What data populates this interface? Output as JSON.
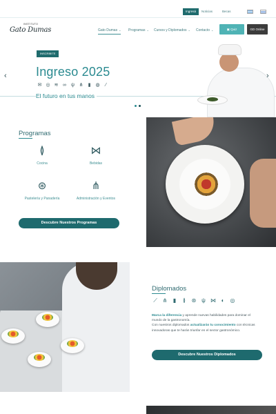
{
  "topbar": {
    "ingresa_label": "Ingresá",
    "links": [
      "Noticias",
      "Becas"
    ]
  },
  "header": {
    "logo_top": "INSTITUTO",
    "logo_name": "Gato Dumas",
    "nav": [
      {
        "label": "Gato Dumas"
      },
      {
        "label": "Programas"
      },
      {
        "label": "Cursos y Diplomados"
      },
      {
        "label": "Contacto"
      }
    ],
    "quiz_label": "Quiz",
    "online_label": "GD Online"
  },
  "hero": {
    "badge": "INSCRIBITE",
    "title": "Ingreso 2025",
    "subtitle": "El futuro en tus manos",
    "icons": [
      "✉",
      "◎",
      "≋",
      "∞",
      "ψ",
      "⋔",
      "▮",
      "◍",
      "⁄"
    ]
  },
  "programas": {
    "title": "Programas",
    "items": [
      {
        "icon": "≬",
        "label": "Cocina"
      },
      {
        "icon": "⋈",
        "label": "Bebidas"
      },
      {
        "icon": "⊛",
        "label": "Pastelería y Panadería"
      },
      {
        "icon": "⋔",
        "label": "Administración y Eventos"
      }
    ],
    "cta": "Descubre Nuestros Programas"
  },
  "diplomados": {
    "title": "Diplomados",
    "icons": [
      "⟋",
      "⋔",
      "▮",
      "≬",
      "⊛",
      "ψ",
      "⋈",
      "◐",
      "◎"
    ],
    "p1_bold": "Marca la diferencia",
    "p1_rest": " y aprende nuevas habilidades para dominar el mundo de la gastronomía.",
    "p2_start": "Con nuestros diplomados ",
    "p2_bold": "actualizarás tu conocimiento",
    "p2_rest": " con técnicas innovadoras que te harán triunfar en el sector gastronómico.",
    "cta": "Descubre Nuestros Diplomados"
  }
}
